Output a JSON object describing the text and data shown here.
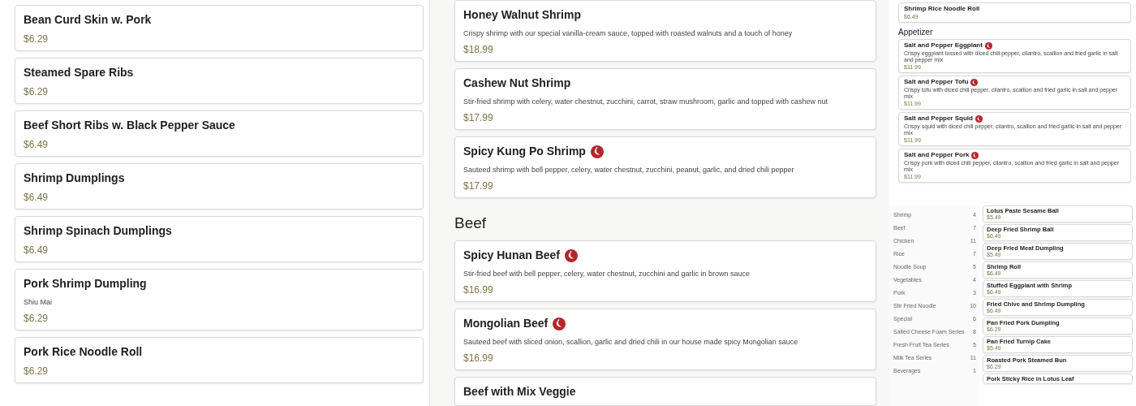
{
  "panels": [
    {
      "kind": "wide_white",
      "sections": [
        {
          "items": [
            {
              "name": "Bean Curd Skin w. Pork",
              "spicy": false,
              "price": "$6.29"
            },
            {
              "name": "Steamed Spare Ribs",
              "spicy": false,
              "price": "$6.29"
            },
            {
              "name": "Beef Short Ribs w. Black Pepper Sauce",
              "spicy": false,
              "price": "$6.49"
            },
            {
              "name": "Shrimp Dumplings",
              "spicy": false,
              "price": "$6.49"
            },
            {
              "name": "Shrimp Spinach Dumplings",
              "spicy": false,
              "price": "$6.49"
            },
            {
              "name": "Pork Shrimp Dumpling",
              "spicy": false,
              "description": "Shiu Mai",
              "price": "$6.29"
            },
            {
              "name": "Pork Rice Noodle Roll",
              "spicy": false,
              "price": "$6.29"
            }
          ]
        }
      ]
    },
    {
      "kind": "wide_shaded",
      "sections": [
        {
          "items": [
            {
              "name": "Honey Walnut Shrimp",
              "spicy": false,
              "description": "Crispy shrimp with our special vanilla-cream sauce, topped with roasted walnuts and a touch of honey",
              "price": "$18.99"
            },
            {
              "name": "Cashew Nut Shrimp",
              "spicy": false,
              "description": "Stir-fried shrimp with celery, water chestnut, zucchini, carrot, straw mushroom, garlic and topped with cashew nut",
              "price": "$17.99"
            },
            {
              "name": "Spicy Kung Po Shrimp",
              "spicy": true,
              "description": "Sauteed shrimp with bell pepper, celery, water chestnut, zucchini, peanut, garlic, and dried chili pepper",
              "price": "$17.99"
            }
          ]
        },
        {
          "heading": "Beef",
          "items": [
            {
              "name": "Spicy Hunan Beef",
              "spicy": true,
              "description": "Stir-fried beef with bell pepper, celery, water chestnut, zucchini and garlic in brown sauce",
              "price": "$16.99"
            },
            {
              "name": "Mongolian Beef",
              "spicy": true,
              "description": "Sauteed beef with sliced onion, scallion, garlic and dried chili in our house made spicy Mongolian sauce",
              "price": "$16.99"
            },
            {
              "name": "Beef with Mix Veggie",
              "spicy": false
            }
          ]
        }
      ]
    },
    {
      "kind": "mini",
      "sections": [
        {
          "items": [
            {
              "name": "Shrimp Rice Noodle Roll",
              "spicy": false,
              "price": "$6.49"
            }
          ]
        },
        {
          "heading": "Appetizer",
          "items": [
            {
              "name": "Salt and Pepper Eggplant",
              "spicy": true,
              "description": "Crispy eggplant tossed with diced chili pepper, cilantro, scallion and fried garlic in salt and pepper mix",
              "price": "$11.99"
            },
            {
              "name": "Salt and Pepper Tofu",
              "spicy": true,
              "description": "Crispy tofu with diced chili pepper, cilantro, scallion and fried garlic in salt and pepper mix",
              "price": "$11.99"
            },
            {
              "name": "Salt and Pepper Squid",
              "spicy": true,
              "description": "Crispy squid with diced chili pepper, cilantro, scallion and fried garlic in salt and pepper mix",
              "price": "$11.99"
            },
            {
              "name": "Salt and Pepper Pork",
              "spicy": true,
              "description": "Crispy pork with diced chili pepper, cilantro, scallion and fried garlic in salt and pepper mix",
              "price": "$11.99"
            }
          ]
        }
      ]
    },
    {
      "kind": "mini_categories",
      "categories": [
        {
          "name": "Shrimp",
          "count": "4"
        },
        {
          "name": "Beef",
          "count": "7"
        },
        {
          "name": "Chicken",
          "count": "11"
        },
        {
          "name": "Rice",
          "count": "7"
        },
        {
          "name": "Noodle Soup",
          "count": "5"
        },
        {
          "name": "Vegetables",
          "count": "4"
        },
        {
          "name": "Pork",
          "count": "3"
        },
        {
          "name": "Stir Fried Noodle",
          "count": "10"
        },
        {
          "name": "Special",
          "count": "6"
        },
        {
          "name": "Salted Cheese Foam Series",
          "count": "8"
        },
        {
          "name": "Fresh Fruit Tea Series",
          "count": "5"
        },
        {
          "name": "Milk Tea Series",
          "count": "11"
        },
        {
          "name": "Beverages",
          "count": "1"
        }
      ],
      "sections": [
        {
          "items": [
            {
              "name": "Lotus Paste Sesame Ball",
              "spicy": false,
              "price": "$5.49"
            },
            {
              "name": "Deep Fried Shrimp Ball",
              "spicy": false,
              "price": "$6.49"
            },
            {
              "name": "Deep Fried Meat Dumpling",
              "spicy": false,
              "price": "$5.49"
            },
            {
              "name": "Shrimp Roll",
              "spicy": false,
              "price": "$6.49"
            },
            {
              "name": "Stuffed Eggplant with Shrimp",
              "spicy": false,
              "price": "$6.49"
            },
            {
              "name": "Fried Chive and Shrimp Dumpling",
              "spicy": false,
              "price": "$6.49"
            },
            {
              "name": "Pan Fried Pork Dumpling",
              "spicy": false,
              "price": "$6.29"
            },
            {
              "name": "Pan Fried Turnip Cake",
              "spicy": false,
              "price": "$5.49"
            },
            {
              "name": "Roasted Pork Steamed Bun",
              "spicy": false,
              "price": "$6.29"
            },
            {
              "name": "Pork Sticky Rice in Lotus Leaf",
              "spicy": false
            }
          ]
        }
      ]
    }
  ]
}
